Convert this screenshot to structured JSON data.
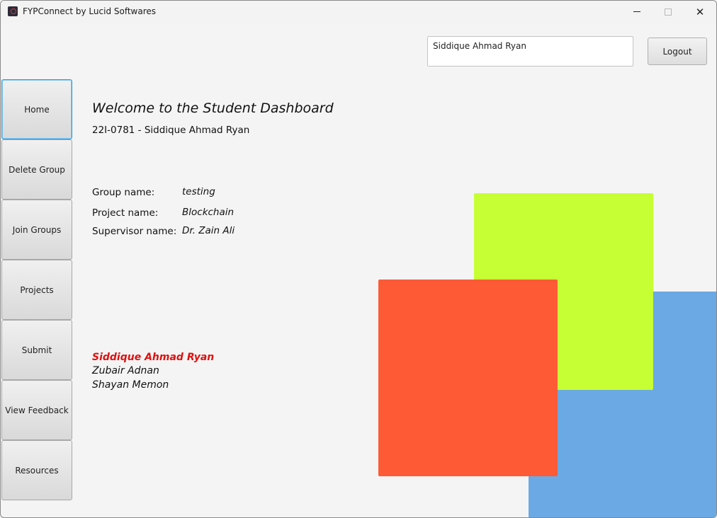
{
  "window": {
    "title": "FYPConnect by Lucid Softwares",
    "close_glyph": "✕"
  },
  "header": {
    "user_name": "Siddique Ahmad Ryan",
    "logout_label": "Logout"
  },
  "sidebar": {
    "items": [
      {
        "label": "Home"
      },
      {
        "label": "Delete Group"
      },
      {
        "label": "Join Groups"
      },
      {
        "label": "Projects"
      },
      {
        "label": "Submit"
      },
      {
        "label": "View Feedback"
      },
      {
        "label": "Resources"
      }
    ]
  },
  "main": {
    "welcome": "Welcome to the Student Dashboard",
    "student_id": "22I-0781 - Siddique Ahmad Ryan",
    "group": {
      "group_label": "Group name:",
      "group_value": "testing",
      "project_label": "Project name:",
      "project_value": "Blockchain",
      "supervisor_label": "Supervisor name:",
      "supervisor_value": "Dr. Zain Ali"
    },
    "members": [
      "Siddique Ahmad Ryan",
      "Zubair Adnan",
      "Shayan Memon"
    ]
  },
  "colors": {
    "accent_blue": "#6aa9e4",
    "accent_lime": "#c6ff33",
    "accent_orange": "#ff5a36",
    "highlight_member": "#e01010"
  }
}
